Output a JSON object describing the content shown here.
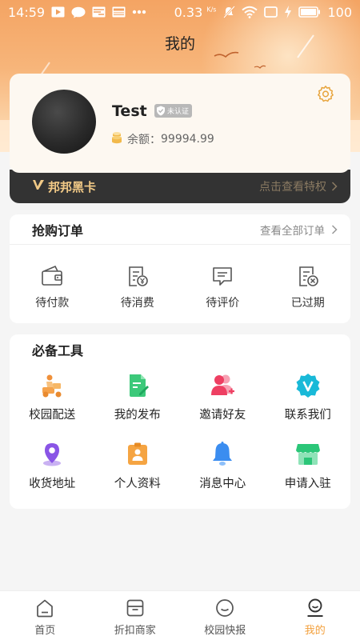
{
  "status_bar": {
    "time": "14:59",
    "network_speed": "0.33",
    "speed_unit": "K/s",
    "battery": "100"
  },
  "header": {
    "title": "我的"
  },
  "profile": {
    "username": "Test",
    "verify_status": "未认证",
    "balance_label": "余额：",
    "balance_value": "99994.99"
  },
  "vip": {
    "title": "邦邦黑卡",
    "link": "点击查看特权"
  },
  "orders": {
    "title": "抢购订单",
    "view_all": "查看全部订单",
    "items": [
      {
        "label": "待付款",
        "icon": "wallet-icon"
      },
      {
        "label": "待消费",
        "icon": "bill-icon"
      },
      {
        "label": "待评价",
        "icon": "comment-icon"
      },
      {
        "label": "已过期",
        "icon": "expired-icon"
      }
    ]
  },
  "tools": {
    "title": "必备工具",
    "items": [
      {
        "label": "校园配送",
        "icon": "delivery-icon"
      },
      {
        "label": "我的发布",
        "icon": "publish-icon"
      },
      {
        "label": "邀请好友",
        "icon": "invite-icon"
      },
      {
        "label": "联系我们",
        "icon": "contact-icon"
      },
      {
        "label": "收货地址",
        "icon": "location-icon"
      },
      {
        "label": "个人资料",
        "icon": "profile-icon"
      },
      {
        "label": "消息中心",
        "icon": "bell-icon"
      },
      {
        "label": "申请入驻",
        "icon": "store-icon"
      }
    ]
  },
  "tabbar": {
    "items": [
      {
        "label": "首页",
        "icon": "home-icon"
      },
      {
        "label": "折扣商家",
        "icon": "shop-icon"
      },
      {
        "label": "校园快报",
        "icon": "news-icon"
      },
      {
        "label": "我的",
        "icon": "me-icon"
      }
    ],
    "active_index": 3
  },
  "colors": {
    "accent": "#f3a03c",
    "header_gradient_top": "#f4a463",
    "vip_bar": "#333333",
    "vip_gold": "#f1c986"
  }
}
